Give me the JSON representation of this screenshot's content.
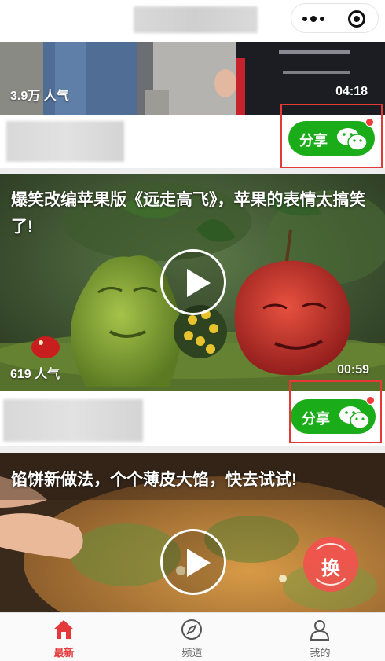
{
  "header": {
    "menu_icon": "more-dots-icon",
    "close_icon": "target-circle-icon"
  },
  "feed": [
    {
      "views": "3.9万 人气",
      "duration": "04:18",
      "share_label": "分享",
      "share_icon": "wechat-icon"
    },
    {
      "title": "爆笑改编苹果版《远走高飞》，苹果的表情太搞笑了!",
      "views": "619 人气",
      "duration": "00:59",
      "share_label": "分享",
      "share_icon": "wechat-icon"
    },
    {
      "title": "馅饼新做法，个个薄皮大馅，快去试试!"
    }
  ],
  "fab": {
    "label": "换",
    "icon": "refresh-icon"
  },
  "tabs": [
    {
      "label": "最新",
      "icon": "home-icon",
      "active": true
    },
    {
      "label": "频道",
      "icon": "compass-icon",
      "active": false
    },
    {
      "label": "我的",
      "icon": "user-icon",
      "active": false
    }
  ],
  "colors": {
    "accent": "#e5383b",
    "share_green": "#1aad19",
    "highlight_box": "#e53935"
  }
}
